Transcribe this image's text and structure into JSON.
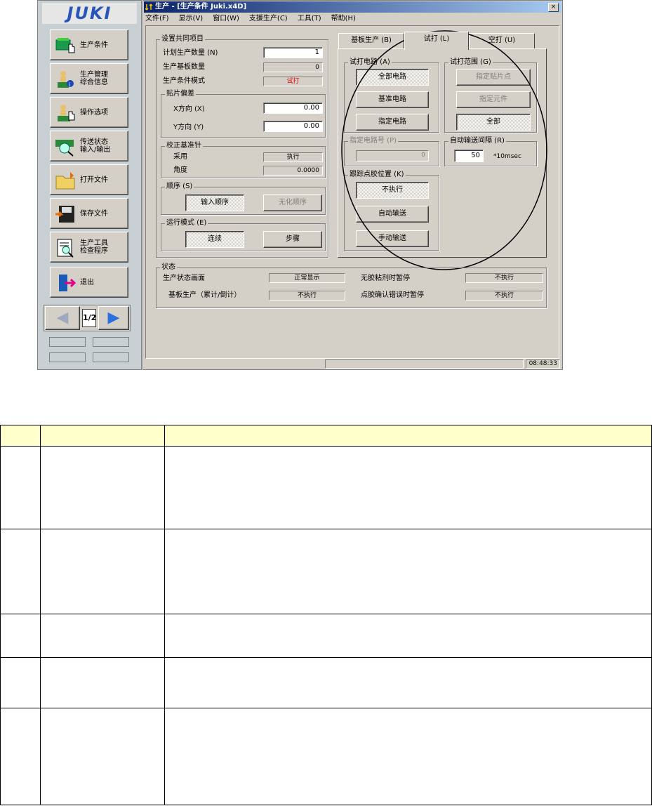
{
  "logo": "JUKI",
  "sidebar": {
    "buttons": [
      {
        "label": "生产条件",
        "icon": "production-condition-icon"
      },
      {
        "label": "生产管理\n综合信息",
        "icon": "management-info-icon"
      },
      {
        "label": "操作选项",
        "icon": "operation-option-icon"
      },
      {
        "label": "传送状态\n输入/输出",
        "icon": "transfer-io-icon"
      },
      {
        "label": "打开文件",
        "icon": "folder-icon"
      },
      {
        "label": "保存文件",
        "icon": "save-icon"
      },
      {
        "label": "生产工具\n检查程序",
        "icon": "tool-check-icon"
      },
      {
        "label": "退出",
        "icon": "exit-icon"
      }
    ],
    "page": "1/2"
  },
  "window": {
    "title": "生产 - [生产条件 Juki.x4D]",
    "close": "×",
    "menu": [
      "文件(F)",
      "显示(V)",
      "窗口(W)",
      "支援生产(C)",
      "工具(T)",
      "帮助(H)"
    ]
  },
  "common": {
    "title": "设置共同项目",
    "plan_label": "计划生产数量 (N)",
    "plan_value": "1",
    "board_label": "生产基板数量",
    "board_value": "0",
    "mode_label": "生产条件模式",
    "mode_value": "试打",
    "offset": {
      "title": "贴片偏差",
      "x_label": "X方向 (X)",
      "x_value": "0.00",
      "y_label": "Y方向 (Y)",
      "y_value": "0.00"
    },
    "calib": {
      "title": "校正基准针",
      "use_label": "采用",
      "use_value": "执行",
      "angle_label": "角度",
      "angle_value": "0.0000"
    },
    "order": {
      "title": "顺序 (S)",
      "input": "输入顺序",
      "optimize": "无化顺序"
    },
    "run": {
      "title": "运行模式 (E)",
      "continuous": "连续",
      "step": "步骤"
    }
  },
  "tabs": [
    "基板生产 (B)",
    "试打 (L)",
    "空打 (U)"
  ],
  "trial": {
    "circuit": {
      "title": "试打电路 (A)",
      "all": "全部电路",
      "base": "基准电路",
      "spec": "指定电路"
    },
    "range": {
      "title": "试打范围 (G)",
      "point": "指定贴片点",
      "part": "指定元件",
      "all": "全部"
    },
    "circuit_no": {
      "title": "指定电路号 (P)",
      "value": "0"
    },
    "auto": {
      "title": "自动输送间隔 (R)",
      "value": "50",
      "unit": "*10msec"
    },
    "track": {
      "title": "跟踪点胶位置 (K)",
      "no": "不执行",
      "auto": "自动输送",
      "manual": "手动输送"
    }
  },
  "state": {
    "title": "状态",
    "r1l": "生产状态画面",
    "r1v": "正常显示",
    "r1l2": "无胶粘剂时暂停",
    "r1v2": "不执行",
    "r2l": "基板生产（累计/倒计）",
    "r2v": "不执行",
    "r2l2": "点胶确认错误时暂停",
    "r2v2": "不执行"
  },
  "statusbar": {
    "time": "08:48:33"
  }
}
